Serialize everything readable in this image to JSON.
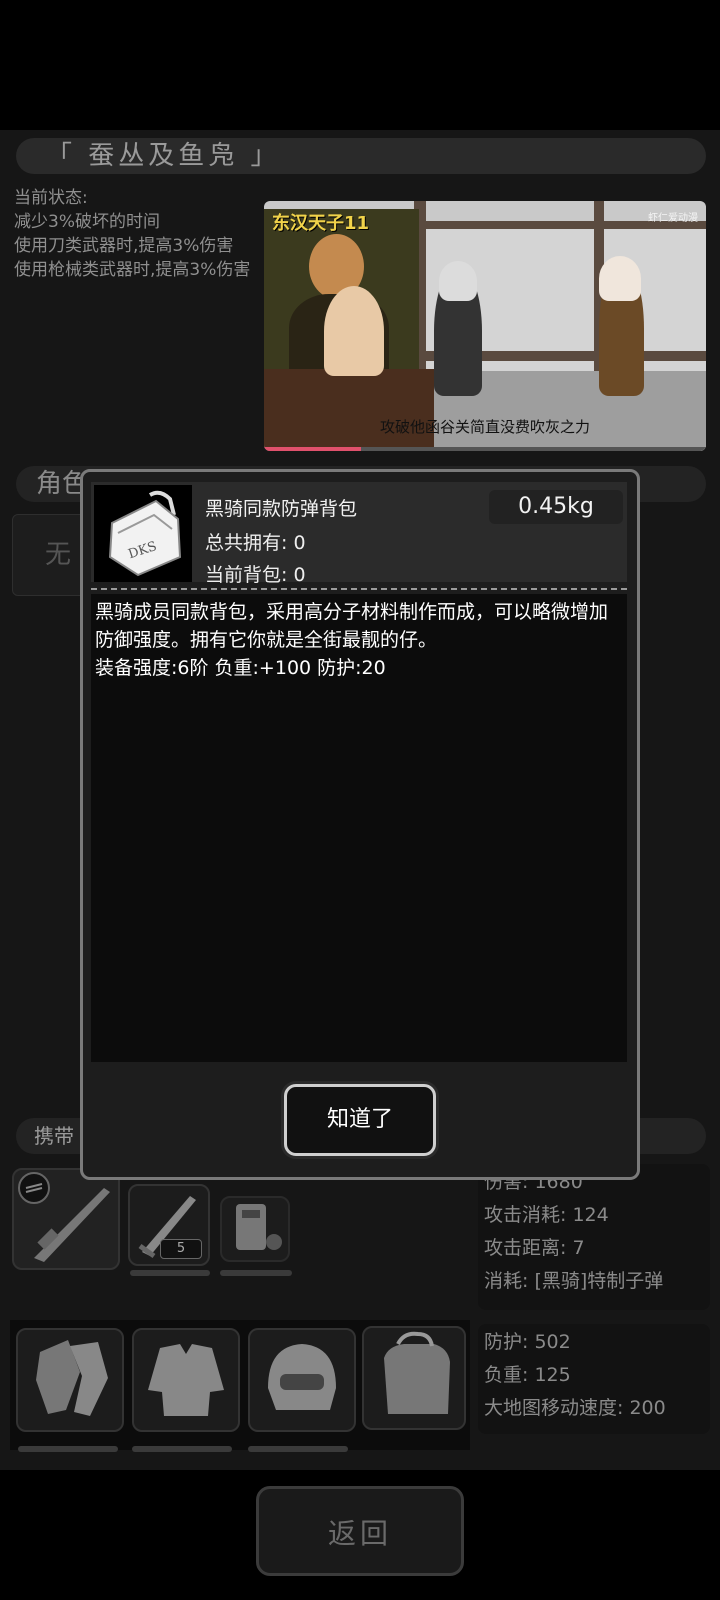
{
  "title": "「  蚕丛及鱼凫  」",
  "status": {
    "heading": "当前状态:",
    "lines": [
      "减少3%破坏的时间",
      "使用刀类武器时,提高3%伤害",
      "使用枪械类武器时,提高3%伤害"
    ]
  },
  "video": {
    "title": "东汉天子11",
    "logo": "虾仁爱动漫",
    "caption": "攻破他函谷关简直没费吹灰之力",
    "progress": 0.22
  },
  "role_section": {
    "label": "角色",
    "button_label": "无"
  },
  "carry_section": {
    "label": "携带"
  },
  "weapon_slot": {
    "ammo_count": "5"
  },
  "weapon_stats": [
    "伤害: 1680",
    "攻击消耗: 124",
    "攻击距离: 7",
    "消耗: [黑骑]特制子弹"
  ],
  "armor_stats": [
    "防护: 502",
    "负重: 125",
    "大地图移动速度: 200"
  ],
  "return_label": "返回",
  "modal": {
    "item_name": "黑骑同款防弹背包",
    "weight": "0.45kg",
    "owned": "总共拥有: 0",
    "in_bag": "当前背包: 0",
    "icon_text": "DKS",
    "description_1": "黑骑成员同款背包，采用高分子材料制作而成，可以略微增加防御强度。拥有它你就是全街最靓的仔。",
    "description_2": "装备强度:6阶  负重:+100 防护:20",
    "ok_label": "知道了"
  }
}
